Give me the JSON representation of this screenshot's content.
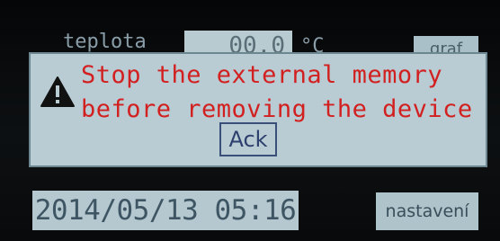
{
  "background": {
    "label": "teplota",
    "value": "00.0",
    "unit": "°C",
    "button_label": "graf"
  },
  "dialog": {
    "line1": "Stop the external memory",
    "line2": "before removing the device",
    "ack_label": "Ack",
    "icon": "warning-icon"
  },
  "footer": {
    "datetime": "2014/05/13 05:16",
    "settings_label": "nastavení"
  },
  "colors": {
    "message": "#d22020",
    "panel": "#b9ccd3",
    "screen": "#0b0d0f"
  }
}
